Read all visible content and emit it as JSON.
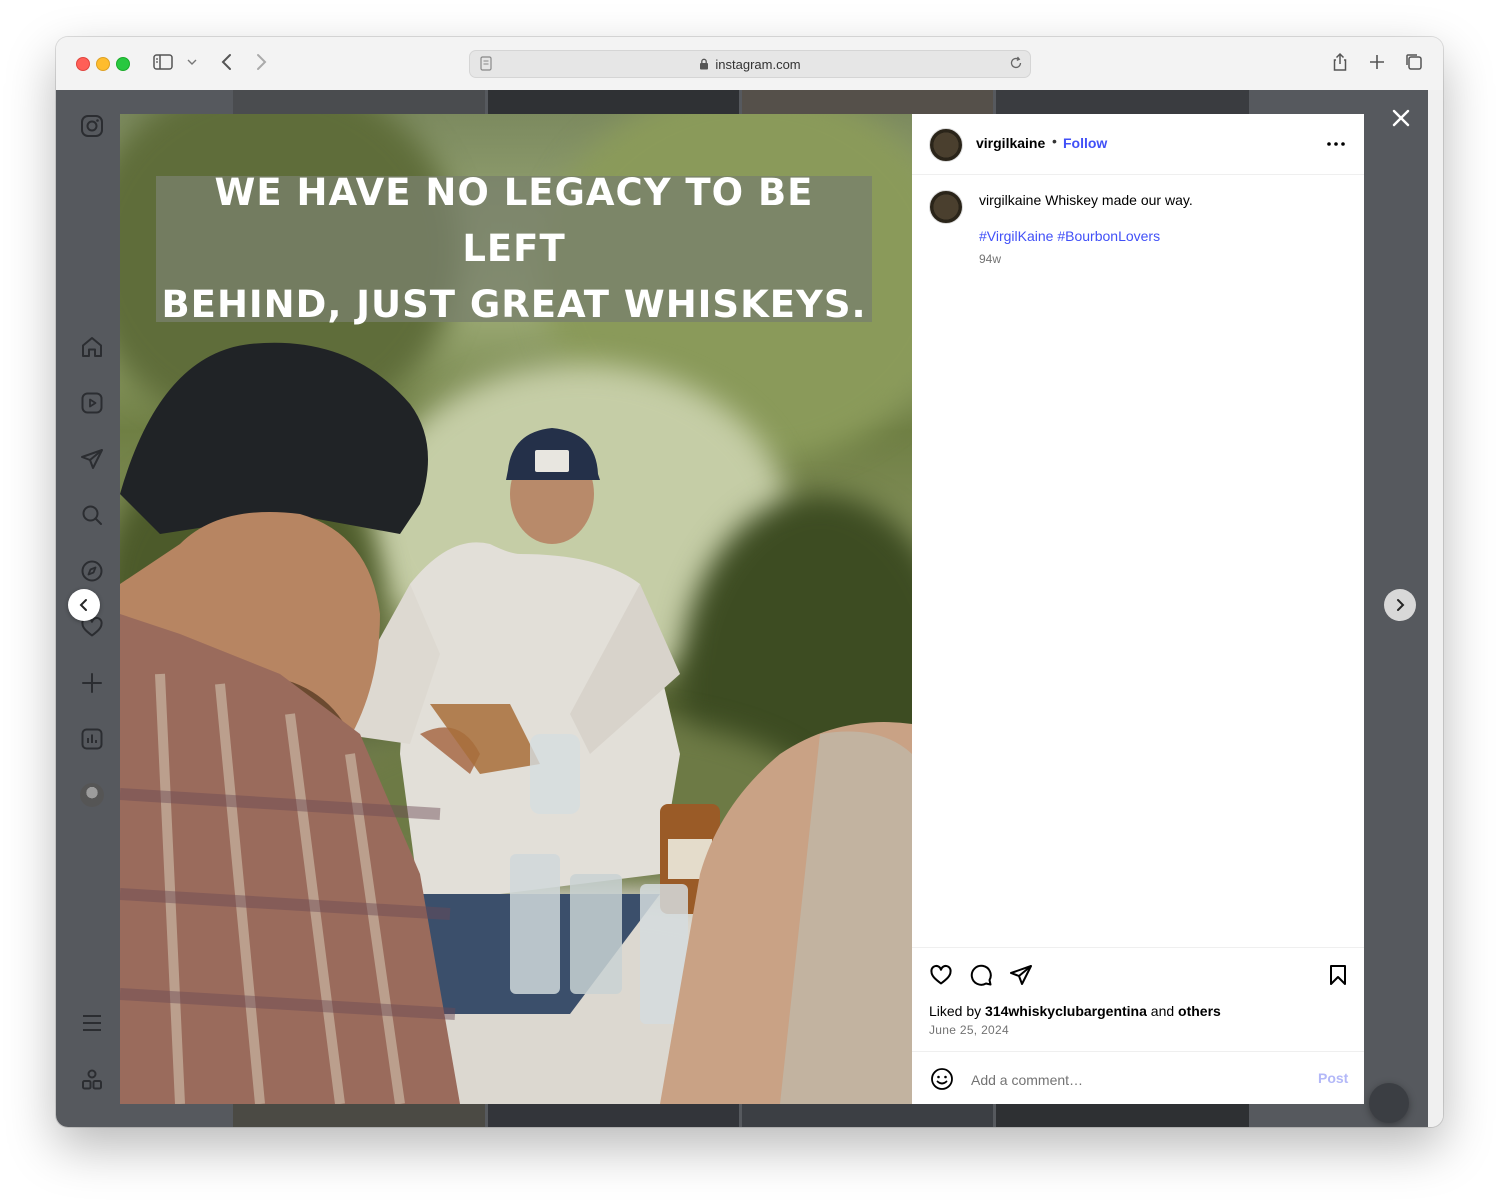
{
  "browser": {
    "url": "instagram.com"
  },
  "post": {
    "image_text_line1": "WE HAVE NO LEGACY TO BE LEFT",
    "image_text_line2": "BEHIND, JUST GREAT WHISKEYS.",
    "author": "virgilkaine",
    "separator": "•",
    "follow_label": "Follow",
    "caption_username": "virgilkaine",
    "caption_text": " Whiskey made our way.",
    "hashtags": [
      "#VirgilKaine",
      "#BourbonLovers"
    ],
    "time_ago": "94w",
    "liked_by_prefix": "Liked by ",
    "liked_by_user": "314whiskyclubargentina",
    "liked_by_middle": " and ",
    "liked_by_others": "others",
    "date": "June 25, 2024",
    "comment_placeholder": "Add a comment…",
    "post_label": "Post"
  },
  "colors": {
    "accent": "#4150f7",
    "overlay": "#56595e"
  }
}
